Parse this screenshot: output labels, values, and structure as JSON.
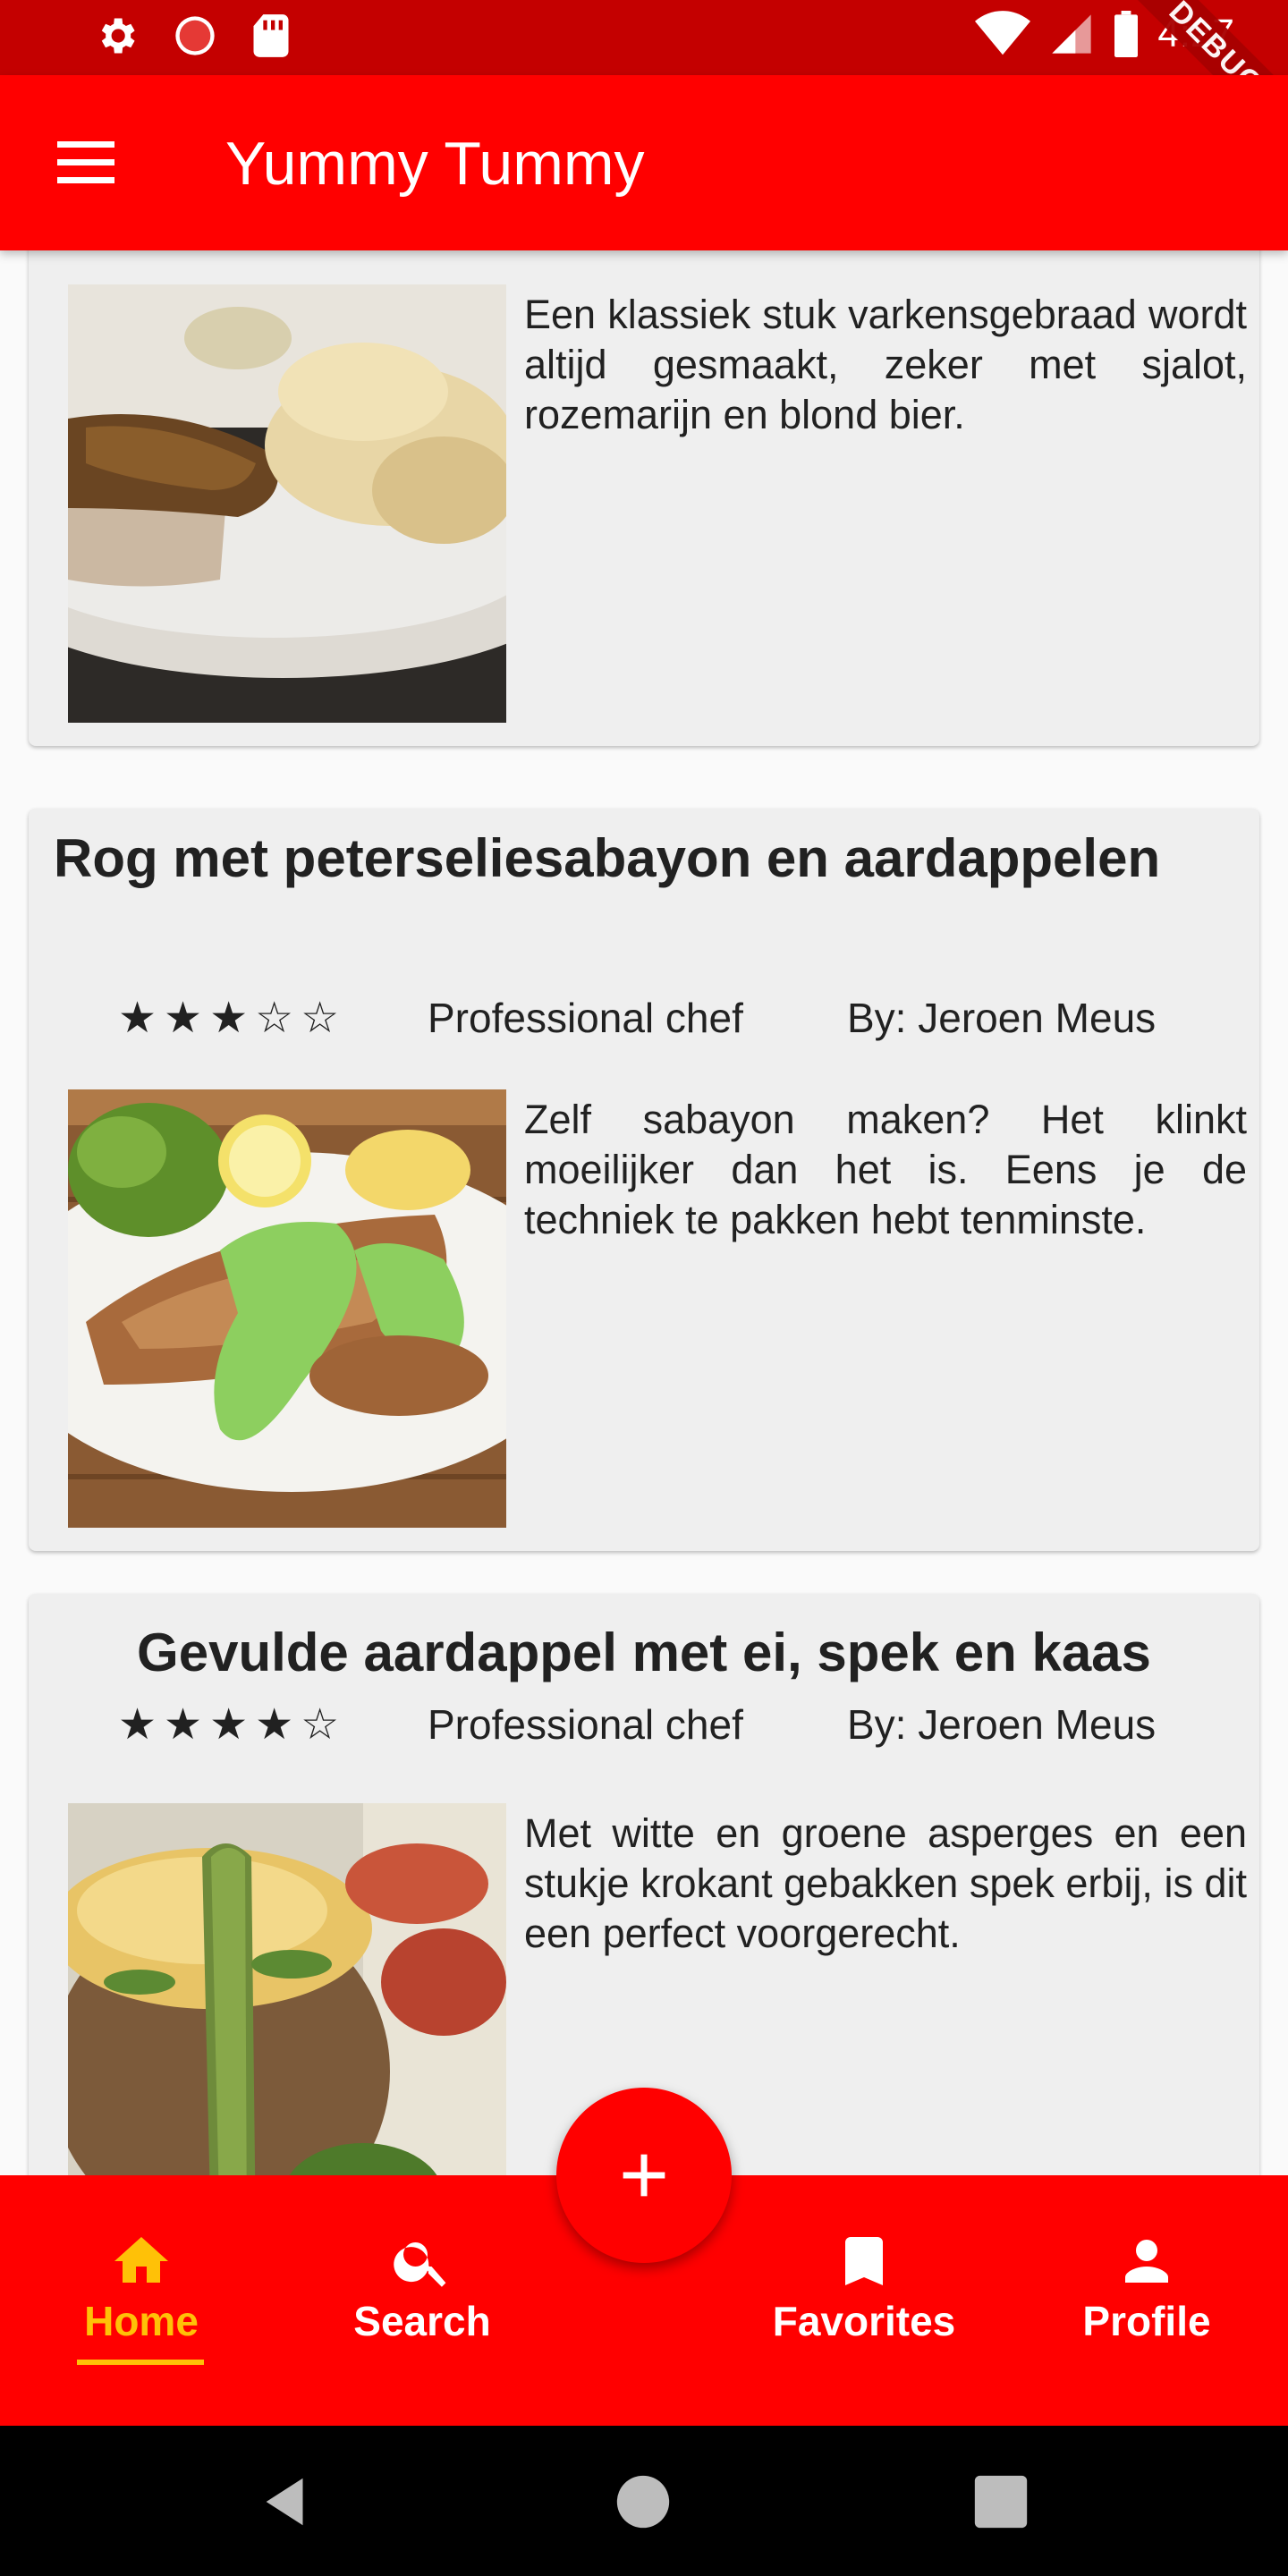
{
  "status_bar": {
    "time": "4:27",
    "debug_label": "DEBUG",
    "left_icons": [
      "settings-icon",
      "record-icon",
      "sd-card-icon"
    ],
    "right_icons": [
      "wifi-icon",
      "signal-icon",
      "battery-icon"
    ]
  },
  "app_bar": {
    "title": "Yummy Tummy",
    "menu_icon": "menu-icon"
  },
  "recipes": [
    {
      "title": "",
      "description": "Een klassiek stuk varkensgebraad wordt altijd gesmaakt, zeker met sjalot, rozemarijn en blond bier."
    },
    {
      "title": "Rog met peterseliesabayon en aardappelen",
      "rating": 3,
      "stars": [
        "★",
        "★",
        "★",
        "☆",
        "☆"
      ],
      "chef_level": "Professional chef",
      "author": "By: Jeroen Meus",
      "description": "Zelf sabayon maken? Het klinkt moeilijker dan het is. Eens je de techniek te pakken hebt tenminste."
    },
    {
      "title": "Gevulde aardappel met ei, spek en kaas",
      "rating": 4,
      "stars": [
        "★",
        "★",
        "★",
        "★",
        "☆"
      ],
      "chef_level": "Professional chef",
      "author": "By: Jeroen Meus",
      "description": "Met witte en groene asperges en een stukje krokant gebakken spek erbij, is dit een perfect voorgerecht."
    }
  ],
  "bottom_nav": {
    "items": [
      {
        "label": "Home",
        "icon": "home-icon",
        "active": true
      },
      {
        "label": "Search",
        "icon": "search-icon",
        "active": false
      },
      {
        "label": "Favorites",
        "icon": "bookmark-icon",
        "active": false
      },
      {
        "label": "Profile",
        "icon": "person-icon",
        "active": false
      }
    ],
    "fab_icon": "plus-icon"
  },
  "colors": {
    "primary": "#ff0000",
    "status_bar": "#c40000",
    "active_nav": "#ffc107",
    "card_bg": "#efefef"
  }
}
